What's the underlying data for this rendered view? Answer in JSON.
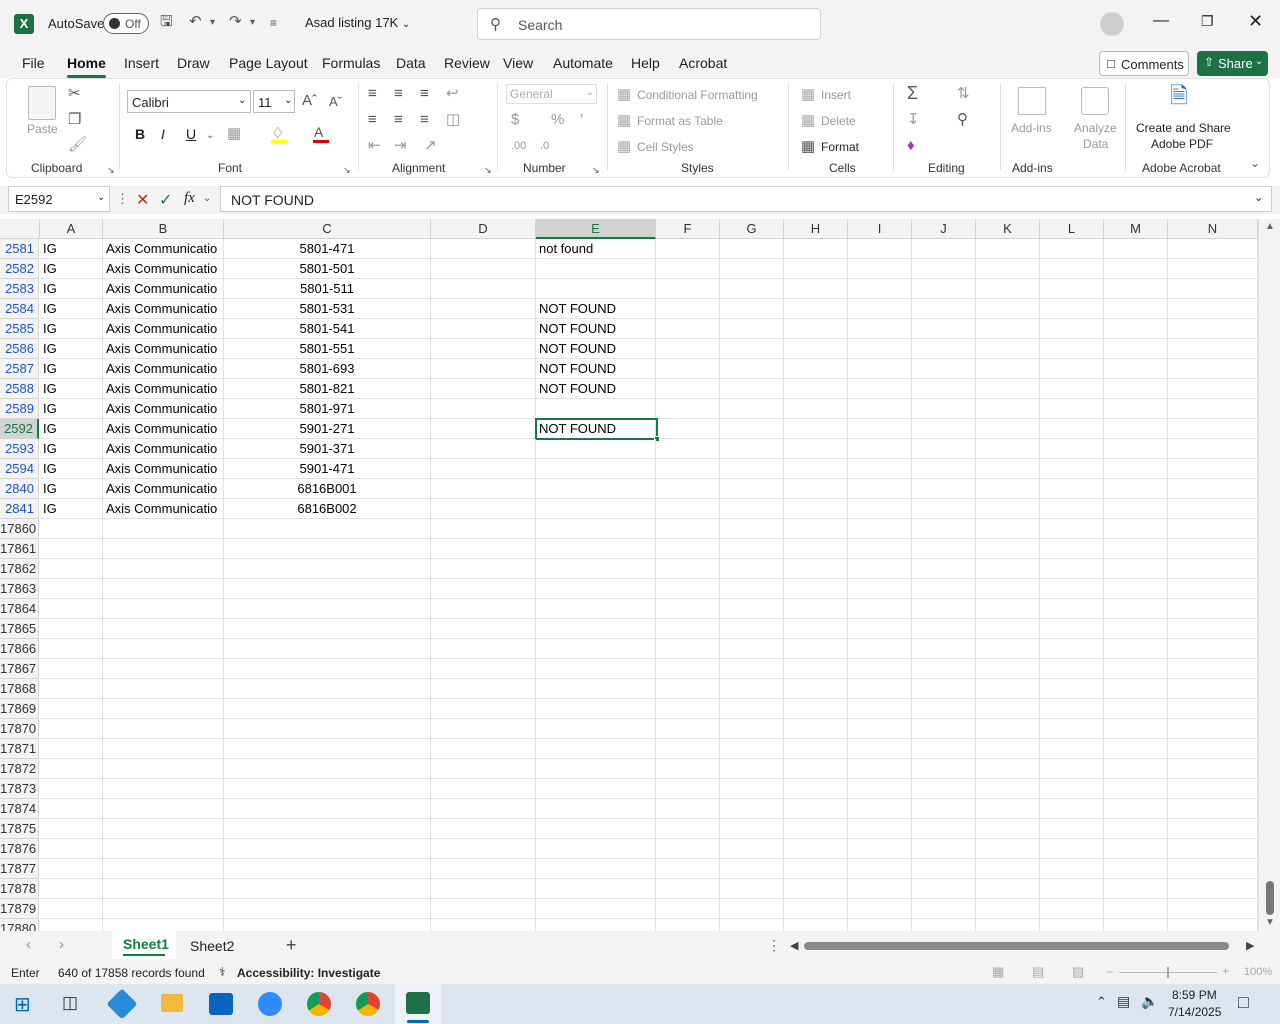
{
  "title_bar": {
    "autosave_label": "AutoSave",
    "autosave_state": "Off",
    "file_name": "Asad listing 17K",
    "search_placeholder": "Search"
  },
  "ribbon_tabs": [
    "File",
    "Home",
    "Insert",
    "Draw",
    "Page Layout",
    "Formulas",
    "Data",
    "Review",
    "View",
    "Automate",
    "Help",
    "Acrobat"
  ],
  "active_tab": "Home",
  "comments_label": "Comments",
  "share_label": "Share",
  "ribbon": {
    "clipboard": {
      "paste": "Paste",
      "group": "Clipboard"
    },
    "font": {
      "family": "Calibri",
      "size": "11",
      "group": "Font",
      "bold": "B",
      "italic": "I",
      "underline": "U"
    },
    "alignment": {
      "group": "Alignment"
    },
    "number": {
      "format": "General",
      "group": "Number"
    },
    "styles": {
      "conditional": "Conditional Formatting",
      "table": "Format as Table",
      "cell_styles": "Cell Styles",
      "group": "Styles"
    },
    "cells": {
      "insert": "Insert",
      "delete": "Delete",
      "format": "Format",
      "group": "Cells"
    },
    "editing": {
      "group": "Editing"
    },
    "addins": {
      "addins": "Add-ins",
      "analyze_line1": "Analyze",
      "analyze_line2": "Data",
      "group": "Add-ins"
    },
    "acrobat": {
      "line1": "Create and Share",
      "line2": "Adobe PDF",
      "group": "Adobe Acrobat"
    }
  },
  "formula_bar": {
    "name_box": "E2592",
    "fx": "fx",
    "content": "NOT FOUND"
  },
  "columns": [
    "A",
    "B",
    "C",
    "D",
    "E",
    "F",
    "G",
    "H",
    "I",
    "J",
    "K",
    "L",
    "M",
    "N"
  ],
  "rows": [
    {
      "n": "2581",
      "a": "IG",
      "b": "Axis Communicatio",
      "c": "5801-471",
      "e": "not found"
    },
    {
      "n": "2582",
      "a": "IG",
      "b": "Axis Communicatio",
      "c": "5801-501",
      "e": ""
    },
    {
      "n": "2583",
      "a": "IG",
      "b": "Axis Communicatio",
      "c": "5801-511",
      "e": ""
    },
    {
      "n": "2584",
      "a": "IG",
      "b": "Axis Communicatio",
      "c": "5801-531",
      "e": "NOT FOUND"
    },
    {
      "n": "2585",
      "a": "IG",
      "b": "Axis Communicatio",
      "c": "5801-541",
      "e": "NOT FOUND"
    },
    {
      "n": "2586",
      "a": "IG",
      "b": "Axis Communicatio",
      "c": "5801-551",
      "e": "NOT FOUND"
    },
    {
      "n": "2587",
      "a": "IG",
      "b": "Axis Communicatio",
      "c": "5801-693",
      "e": "NOT FOUND"
    },
    {
      "n": "2588",
      "a": "IG",
      "b": "Axis Communicatio",
      "c": "5801-821",
      "e": "NOT FOUND"
    },
    {
      "n": "2589",
      "a": "IG",
      "b": "Axis Communicatio",
      "c": "5801-971",
      "e": ""
    },
    {
      "n": "2592",
      "a": "IG",
      "b": "Axis Communicatio",
      "c": "5901-271",
      "e": "NOT FOUND"
    },
    {
      "n": "2593",
      "a": "IG",
      "b": "Axis Communicatio",
      "c": "5901-371",
      "e": ""
    },
    {
      "n": "2594",
      "a": "IG",
      "b": "Axis Communicatio",
      "c": "5901-471",
      "e": ""
    },
    {
      "n": "2840",
      "a": "IG",
      "b": "Axis Communicatio",
      "c": "6816B001",
      "e": ""
    },
    {
      "n": "2841",
      "a": "IG",
      "b": "Axis Communicatio",
      "c": "6816B002",
      "e": ""
    },
    {
      "n": "17860",
      "a": "",
      "b": "",
      "c": "",
      "e": ""
    },
    {
      "n": "17861",
      "a": "",
      "b": "",
      "c": "",
      "e": ""
    },
    {
      "n": "17862",
      "a": "",
      "b": "",
      "c": "",
      "e": ""
    },
    {
      "n": "17863",
      "a": "",
      "b": "",
      "c": "",
      "e": ""
    },
    {
      "n": "17864",
      "a": "",
      "b": "",
      "c": "",
      "e": ""
    },
    {
      "n": "17865",
      "a": "",
      "b": "",
      "c": "",
      "e": ""
    },
    {
      "n": "17866",
      "a": "",
      "b": "",
      "c": "",
      "e": ""
    },
    {
      "n": "17867",
      "a": "",
      "b": "",
      "c": "",
      "e": ""
    },
    {
      "n": "17868",
      "a": "",
      "b": "",
      "c": "",
      "e": ""
    },
    {
      "n": "17869",
      "a": "",
      "b": "",
      "c": "",
      "e": ""
    },
    {
      "n": "17870",
      "a": "",
      "b": "",
      "c": "",
      "e": ""
    },
    {
      "n": "17871",
      "a": "",
      "b": "",
      "c": "",
      "e": ""
    },
    {
      "n": "17872",
      "a": "",
      "b": "",
      "c": "",
      "e": ""
    },
    {
      "n": "17873",
      "a": "",
      "b": "",
      "c": "",
      "e": ""
    },
    {
      "n": "17874",
      "a": "",
      "b": "",
      "c": "",
      "e": ""
    },
    {
      "n": "17875",
      "a": "",
      "b": "",
      "c": "",
      "e": ""
    },
    {
      "n": "17876",
      "a": "",
      "b": "",
      "c": "",
      "e": ""
    },
    {
      "n": "17877",
      "a": "",
      "b": "",
      "c": "",
      "e": ""
    },
    {
      "n": "17878",
      "a": "",
      "b": "",
      "c": "",
      "e": ""
    },
    {
      "n": "17879",
      "a": "",
      "b": "",
      "c": "",
      "e": ""
    },
    {
      "n": "17880",
      "a": "",
      "b": "",
      "c": "",
      "e": ""
    }
  ],
  "selected_row": "2592",
  "selected_col": "E",
  "sheets": [
    "Sheet1",
    "Sheet2"
  ],
  "active_sheet": "Sheet1",
  "status": {
    "mode": "Enter",
    "records": "640 of 17858 records found",
    "accessibility": "Accessibility: Investigate",
    "zoom": "100%"
  },
  "taskbar": {
    "time": "8:59 PM",
    "date": "7/14/2025"
  },
  "colors": {
    "accent": "#217346",
    "share_bg": "#1e7145",
    "row_blue": "#1a56c8",
    "selection": "#107c41"
  }
}
